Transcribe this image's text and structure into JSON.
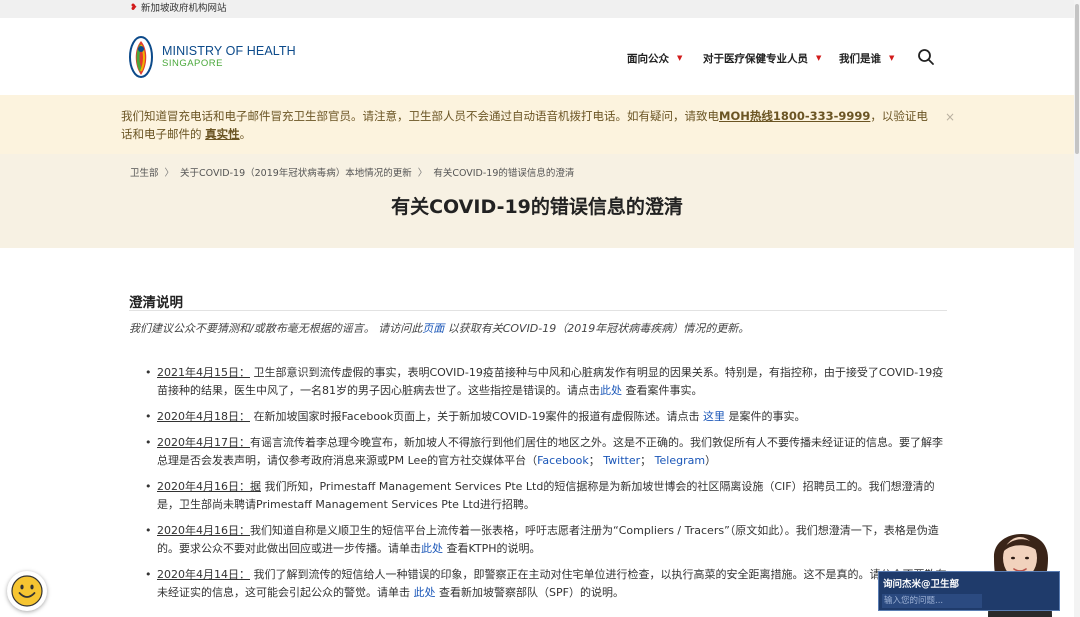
{
  "gov_bar": {
    "text": "新加坡政府机构网站"
  },
  "header": {
    "logo_name": "MINISTRY OF HEALTH",
    "logo_sub": "SINGAPORE",
    "nav": [
      {
        "label": "面向公众"
      },
      {
        "label": "对于医疗保健专业人员"
      },
      {
        "label": "我们是谁"
      }
    ]
  },
  "alert": {
    "text_1": "我们知道冒充电话和电子邮件冒充卫生部官员。请注意，卫生部人员不会通过自动语音机拨打电话。如有疑问，请致电",
    "hotline": "MOH热线1800-333-9999",
    "text_2": "，以验证电话和电子邮件的",
    "authenticity": "真实性",
    "text_3": "。",
    "close": "×"
  },
  "breadcrumbs": [
    "卫生部",
    "关于COVID-19（2019年冠状病毒病）本地情况的更新",
    "有关COVID-19的错误信息的澄清"
  ],
  "breadcrumb_sep": "〉",
  "page_title": "有关COVID-19的错误信息的澄清",
  "section": {
    "heading": "澄清说明",
    "intro_1": "我们建议公众不要猜测和/或散布毫无根据的谣言。 请访问此",
    "intro_link": "页面",
    "intro_2": "以获取有关COVID-19（2019年冠状病毒疾病）情况的更新。"
  },
  "items": [
    {
      "date": "2021年4月15日：",
      "t1": "卫生部意识到流传虚假的事实，表明COVID-19疫苗接种与中风和心脏病发作有明显的因果关系。特别是，有指控称，由于接受了COVID-19疫苗接种的结果，医生中风了，一名81岁的男子因心脏病去世了。这些指控是错误的。请点击",
      "link": "此处",
      "t2": " 查看案件事实。"
    },
    {
      "date": "2020年4月18日：",
      "t1": " 在新加坡国家时报Facebook页面上，关于新加坡COVID-19案件的报道有虚假陈述。请点击 ",
      "link": "这里",
      "t2": " 是案件的事实。"
    },
    {
      "date": "2020年4月17日：",
      "t1": "有谣言流传着李总理今晚宣布，新加坡人不得旅行到他们居住的地区之外。这是不正确的。我们敦促所有人不要传播未经证证的信息。要了解李总理是否会发表声明，请仅参考政府消息来源或PM Lee的官方社交媒体平台（",
      "link": "Facebook",
      "t2": "；",
      "link2": "Twitter",
      "t3": "；",
      "link3": "Telegram",
      "t4": "）"
    },
    {
      "date": "2020年4月16日：",
      "date_extra": "据",
      "t1": " 我们所知，Primestaff Management Services Pte Ltd的短信据称是为新加坡世博会的社区隔离设施（CIF）招聘员工的。我们想澄清的是，卫生部尚未聘请Primestaff Management Services Pte Ltd进行招聘。"
    },
    {
      "date": "2020年4月16日：",
      "t1": "我们知道自称是义顺卫生的短信平台上流传着一张表格，呼吁志愿者注册为“Compliers / Tracers”（原文如此）。我们想澄清一下，表格是伪造的。要求公众不要对此做出回应或进一步传播。请单击",
      "link": "此处",
      "t2": " 查看KTPH的说明。"
    },
    {
      "date": "2020年4月14日：",
      "t1": " 我们了解到流传的短信给人一种错误的印象，即警察正在主动对住宅单位进行检查，以执行高菜的安全距离措施。这不是真的。请公众不要散布未经证实的信息，这可能会引起公众的警觉。请单击 ",
      "link": "此处",
      "t2": " 查看新加坡警察部队（SPF）的说明。"
    }
  ],
  "chat": {
    "jamie_title": "询问杰米@卫生部",
    "jamie_placeholder": "输入您的问题..."
  }
}
